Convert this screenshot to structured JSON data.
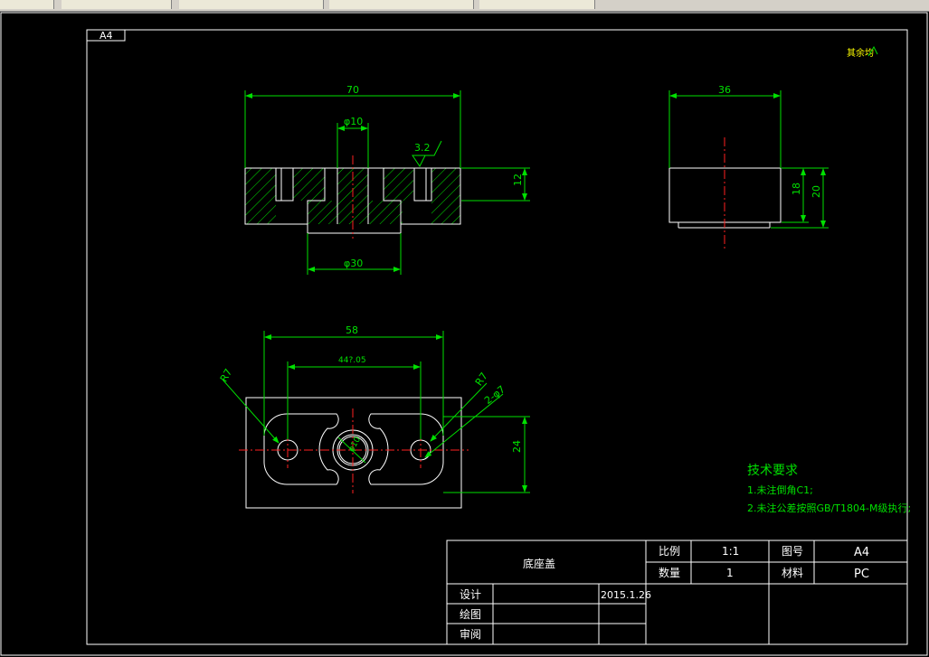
{
  "tabs": [
    "",
    "",
    "",
    "",
    ""
  ],
  "sheet_size": "A4",
  "annotation_top_right": "其余均",
  "dims": {
    "width_top": "70",
    "hole_top": "φ10",
    "roughness": "3.2",
    "thickness_top": "12",
    "boss_dia": "φ30",
    "width_side": "36",
    "h18": "18",
    "h20": "20",
    "width_plan": "58",
    "pitch": "44?.05",
    "r7_left": "R7",
    "r7_right": "R7",
    "two_holes": "2-φ7",
    "center_hole": "φ10",
    "height_plan": "24"
  },
  "notes": {
    "title": "技术要求",
    "line1": "1.未注倒角C1;",
    "line2": "2.未注公差按照GB/T1804-M级执行;"
  },
  "title_block": {
    "part_name": "底座盖",
    "scale_label": "比例",
    "scale_value": "1:1",
    "drawing_no_label": "图号",
    "drawing_no_value": "A4",
    "qty_label": "数量",
    "qty_value": "1",
    "material_label": "材料",
    "material_value": "PC",
    "design_label": "设计",
    "design_date": "2015.1.26",
    "draw_label": "绘图",
    "review_label": "审阅"
  },
  "colors": {
    "background": "#000000",
    "outline": "#ffffff",
    "dimension": "#00e000",
    "centerline": "#ff2020"
  }
}
